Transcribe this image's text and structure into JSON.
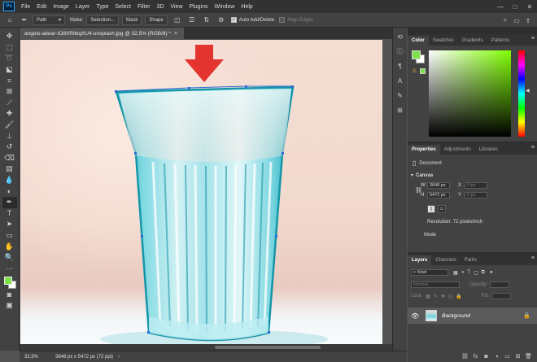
{
  "menu": {
    "logo": "Ps",
    "items": [
      "File",
      "Edit",
      "Image",
      "Layer",
      "Type",
      "Select",
      "Filter",
      "3D",
      "View",
      "Plugins",
      "Window",
      "Help"
    ]
  },
  "window_controls": {
    "minimize": "—",
    "maximize": "□",
    "close": "✕"
  },
  "options": {
    "mode_value": "Path",
    "make_label": "Make:",
    "selection_label": "Selection...",
    "mask_label": "Mask",
    "shape_label": "Shape",
    "auto_add_delete_label": "Auto Add/Delete",
    "align_edges_label": "Align Edges"
  },
  "document": {
    "tab_title": "angelo-abear-IO8XRitkqXU4-unsplash.jpg @ 32,5% (RGB/8) *",
    "close": "×"
  },
  "status": {
    "zoom": "32,5%",
    "info": "3648 px x 5472 px (72 ppi)",
    "arrow": "›"
  },
  "color_panel": {
    "tabs": [
      "Color",
      "Swatches",
      "Gradients",
      "Patterns"
    ],
    "active_tab": "Color",
    "foreground": "#7ee04a",
    "background": "#ffffff",
    "warning": "⚠"
  },
  "properties_panel": {
    "tabs": [
      "Properties",
      "Adjustments",
      "Libraries"
    ],
    "active_tab": "Properties",
    "document_label": "Document",
    "canvas_label": "Canvas",
    "w_label": "W",
    "w_value": "3648 px",
    "h_label": "H",
    "h_value": "5472 px",
    "x_label": "X",
    "x_value": "0 px",
    "y_label": "Y",
    "y_value": "0 px",
    "resolution": "Resolution: 72 pixels/inch",
    "mode_label": "Mode"
  },
  "layers_panel": {
    "tabs": [
      "Layers",
      "Channels",
      "Paths"
    ],
    "active_tab": "Layers",
    "kind_label": "Kind",
    "blend_mode": "Normal",
    "opacity_label": "Opacity:",
    "lock_label": "Lock:",
    "fill_label": "Fill:",
    "layer_name": "Background"
  },
  "annotation": {
    "arrow_color": "#e3342f"
  }
}
